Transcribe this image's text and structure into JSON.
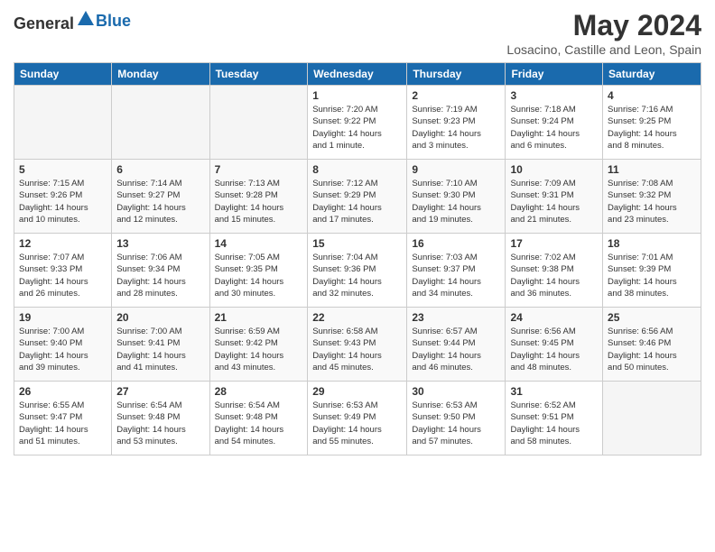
{
  "header": {
    "logo_general": "General",
    "logo_blue": "Blue",
    "month_year": "May 2024",
    "location": "Losacino, Castille and Leon, Spain"
  },
  "days_of_week": [
    "Sunday",
    "Monday",
    "Tuesday",
    "Wednesday",
    "Thursday",
    "Friday",
    "Saturday"
  ],
  "weeks": [
    [
      {
        "day": "",
        "info": ""
      },
      {
        "day": "",
        "info": ""
      },
      {
        "day": "",
        "info": ""
      },
      {
        "day": "1",
        "info": "Sunrise: 7:20 AM\nSunset: 9:22 PM\nDaylight: 14 hours\nand 1 minute."
      },
      {
        "day": "2",
        "info": "Sunrise: 7:19 AM\nSunset: 9:23 PM\nDaylight: 14 hours\nand 3 minutes."
      },
      {
        "day": "3",
        "info": "Sunrise: 7:18 AM\nSunset: 9:24 PM\nDaylight: 14 hours\nand 6 minutes."
      },
      {
        "day": "4",
        "info": "Sunrise: 7:16 AM\nSunset: 9:25 PM\nDaylight: 14 hours\nand 8 minutes."
      }
    ],
    [
      {
        "day": "5",
        "info": "Sunrise: 7:15 AM\nSunset: 9:26 PM\nDaylight: 14 hours\nand 10 minutes."
      },
      {
        "day": "6",
        "info": "Sunrise: 7:14 AM\nSunset: 9:27 PM\nDaylight: 14 hours\nand 12 minutes."
      },
      {
        "day": "7",
        "info": "Sunrise: 7:13 AM\nSunset: 9:28 PM\nDaylight: 14 hours\nand 15 minutes."
      },
      {
        "day": "8",
        "info": "Sunrise: 7:12 AM\nSunset: 9:29 PM\nDaylight: 14 hours\nand 17 minutes."
      },
      {
        "day": "9",
        "info": "Sunrise: 7:10 AM\nSunset: 9:30 PM\nDaylight: 14 hours\nand 19 minutes."
      },
      {
        "day": "10",
        "info": "Sunrise: 7:09 AM\nSunset: 9:31 PM\nDaylight: 14 hours\nand 21 minutes."
      },
      {
        "day": "11",
        "info": "Sunrise: 7:08 AM\nSunset: 9:32 PM\nDaylight: 14 hours\nand 23 minutes."
      }
    ],
    [
      {
        "day": "12",
        "info": "Sunrise: 7:07 AM\nSunset: 9:33 PM\nDaylight: 14 hours\nand 26 minutes."
      },
      {
        "day": "13",
        "info": "Sunrise: 7:06 AM\nSunset: 9:34 PM\nDaylight: 14 hours\nand 28 minutes."
      },
      {
        "day": "14",
        "info": "Sunrise: 7:05 AM\nSunset: 9:35 PM\nDaylight: 14 hours\nand 30 minutes."
      },
      {
        "day": "15",
        "info": "Sunrise: 7:04 AM\nSunset: 9:36 PM\nDaylight: 14 hours\nand 32 minutes."
      },
      {
        "day": "16",
        "info": "Sunrise: 7:03 AM\nSunset: 9:37 PM\nDaylight: 14 hours\nand 34 minutes."
      },
      {
        "day": "17",
        "info": "Sunrise: 7:02 AM\nSunset: 9:38 PM\nDaylight: 14 hours\nand 36 minutes."
      },
      {
        "day": "18",
        "info": "Sunrise: 7:01 AM\nSunset: 9:39 PM\nDaylight: 14 hours\nand 38 minutes."
      }
    ],
    [
      {
        "day": "19",
        "info": "Sunrise: 7:00 AM\nSunset: 9:40 PM\nDaylight: 14 hours\nand 39 minutes."
      },
      {
        "day": "20",
        "info": "Sunrise: 7:00 AM\nSunset: 9:41 PM\nDaylight: 14 hours\nand 41 minutes."
      },
      {
        "day": "21",
        "info": "Sunrise: 6:59 AM\nSunset: 9:42 PM\nDaylight: 14 hours\nand 43 minutes."
      },
      {
        "day": "22",
        "info": "Sunrise: 6:58 AM\nSunset: 9:43 PM\nDaylight: 14 hours\nand 45 minutes."
      },
      {
        "day": "23",
        "info": "Sunrise: 6:57 AM\nSunset: 9:44 PM\nDaylight: 14 hours\nand 46 minutes."
      },
      {
        "day": "24",
        "info": "Sunrise: 6:56 AM\nSunset: 9:45 PM\nDaylight: 14 hours\nand 48 minutes."
      },
      {
        "day": "25",
        "info": "Sunrise: 6:56 AM\nSunset: 9:46 PM\nDaylight: 14 hours\nand 50 minutes."
      }
    ],
    [
      {
        "day": "26",
        "info": "Sunrise: 6:55 AM\nSunset: 9:47 PM\nDaylight: 14 hours\nand 51 minutes."
      },
      {
        "day": "27",
        "info": "Sunrise: 6:54 AM\nSunset: 9:48 PM\nDaylight: 14 hours\nand 53 minutes."
      },
      {
        "day": "28",
        "info": "Sunrise: 6:54 AM\nSunset: 9:48 PM\nDaylight: 14 hours\nand 54 minutes."
      },
      {
        "day": "29",
        "info": "Sunrise: 6:53 AM\nSunset: 9:49 PM\nDaylight: 14 hours\nand 55 minutes."
      },
      {
        "day": "30",
        "info": "Sunrise: 6:53 AM\nSunset: 9:50 PM\nDaylight: 14 hours\nand 57 minutes."
      },
      {
        "day": "31",
        "info": "Sunrise: 6:52 AM\nSunset: 9:51 PM\nDaylight: 14 hours\nand 58 minutes."
      },
      {
        "day": "",
        "info": ""
      }
    ]
  ]
}
